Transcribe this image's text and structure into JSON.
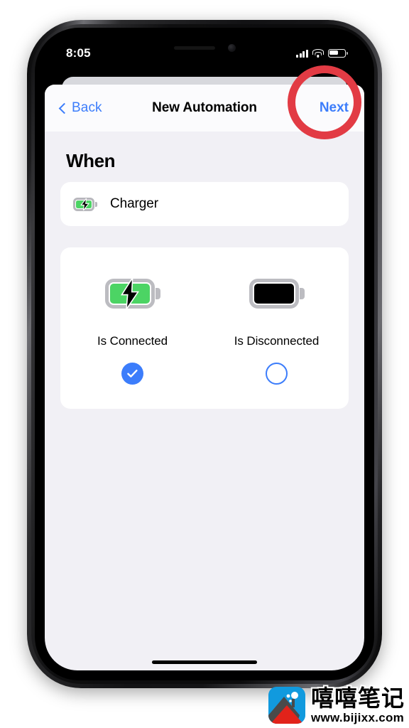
{
  "status_bar": {
    "time": "8:05",
    "cellular_icon": "signal-bars-icon",
    "wifi_icon": "wifi-icon",
    "battery_icon": "battery-icon"
  },
  "nav": {
    "back_label": "Back",
    "back_icon": "chevron-left-icon",
    "title": "New Automation",
    "next_label": "Next"
  },
  "content": {
    "section_title": "When",
    "trigger_row": {
      "icon": "charging-battery-icon",
      "label": "Charger"
    },
    "options": [
      {
        "icon": "charging-battery-icon",
        "label": "Is Connected",
        "selected": true,
        "radio_icon": "checkmark-circle-filled-icon"
      },
      {
        "icon": "empty-battery-icon",
        "label": "Is Disconnected",
        "selected": false,
        "radio_icon": "circle-outline-icon"
      }
    ]
  },
  "annotation": {
    "highlight_ring": "red-circle-highlight",
    "color": "#e23b44",
    "target": "Next"
  },
  "watermark": {
    "logo_icon": "mountain-logo-icon",
    "brand": "嘻嘻笔记",
    "url": "www.bijixx.com"
  },
  "theme": {
    "accent_blue": "#3c7dfb",
    "battery_green": "#4cd464",
    "page_background": "#f1f0f5",
    "card_background": "#ffffff"
  }
}
